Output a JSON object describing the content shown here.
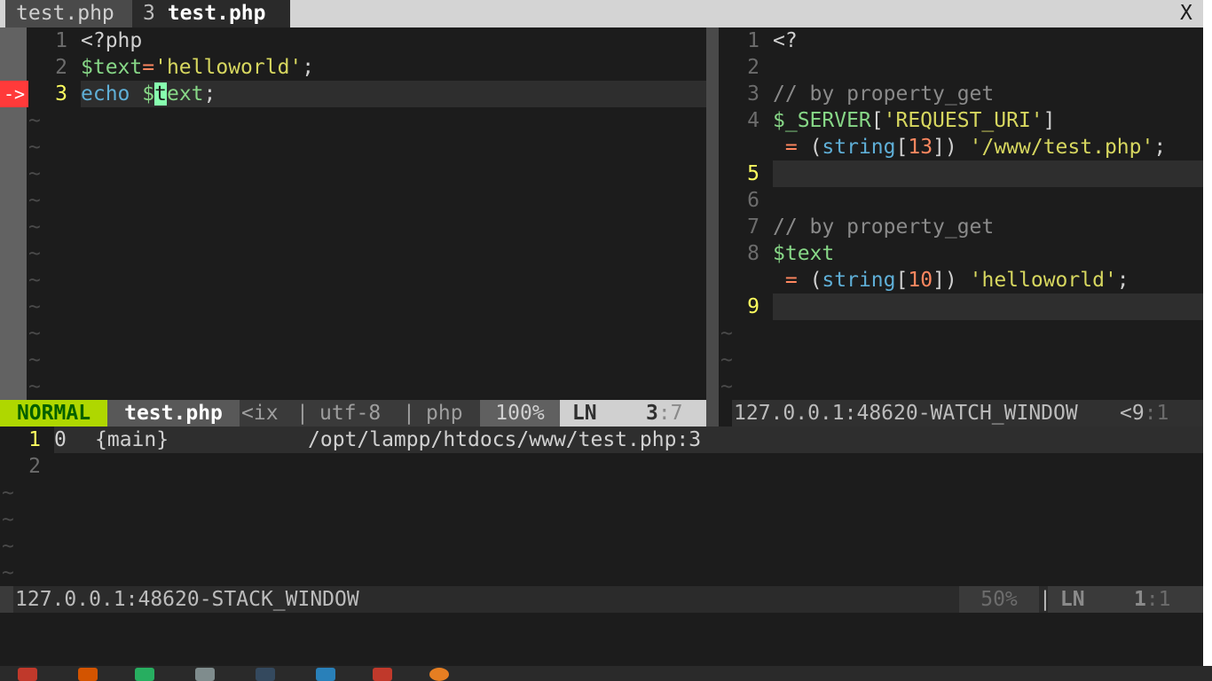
{
  "tabline": {
    "tab1": "test.php",
    "tab2_num": "3",
    "tab2": "test.php",
    "close": "X"
  },
  "left_pane": {
    "sign": "->",
    "lines": [
      {
        "num": "1",
        "code": "<?php"
      },
      {
        "num": "2",
        "code": "$text='helloworld';"
      },
      {
        "num": "3",
        "code": "echo $text;"
      }
    ],
    "tilde": "~"
  },
  "left_status": {
    "mode": "NORMAL",
    "file": "test.php",
    "fileformat": "<ix",
    "sep": "|",
    "encoding": "utf-8",
    "filetype": "php",
    "percent": "100%",
    "ln_label": "LN",
    "line": "3",
    "col": ":7"
  },
  "right_pane": {
    "lines": [
      {
        "num": "1",
        "text": "<?"
      },
      {
        "num": "2",
        "text": ""
      },
      {
        "num": "3",
        "text": "// by property_get"
      },
      {
        "num": "4",
        "text": "$_SERVER['REQUEST_URI']"
      },
      {
        "num": "",
        "text": " = (string[13]) '/www/test.php';"
      },
      {
        "num": "5",
        "text": ""
      },
      {
        "num": "6",
        "text": ""
      },
      {
        "num": "7",
        "text": "// by property_get"
      },
      {
        "num": "8",
        "text": "$text"
      },
      {
        "num": "",
        "text": " = (string[10]) 'helloworld';"
      },
      {
        "num": "9",
        "text": ""
      }
    ],
    "tilde": "~"
  },
  "right_status": {
    "name": "127.0.0.1:48620-WATCH_WINDOW",
    "pos": "<9",
    "col": ":1"
  },
  "stack_pane": {
    "rows": [
      {
        "num": "1",
        "level": "0",
        "where": "{main}",
        "file": "/opt/lampp/htdocs/www/test.php:3"
      },
      {
        "num": "2",
        "level": "",
        "where": "",
        "file": ""
      }
    ],
    "tilde": "~"
  },
  "bottom_status": {
    "name": "127.0.0.1:48620-STACK_WINDOW",
    "percent": "50%",
    "bar": "|",
    "ln_label": "LN",
    "line": "1",
    "col": ":1"
  },
  "colors": {
    "background": "#1c1c1c",
    "mode_normal": "#afd700",
    "error_sign": "#ff3a3a",
    "current_line_nr": "#ffff5f"
  }
}
